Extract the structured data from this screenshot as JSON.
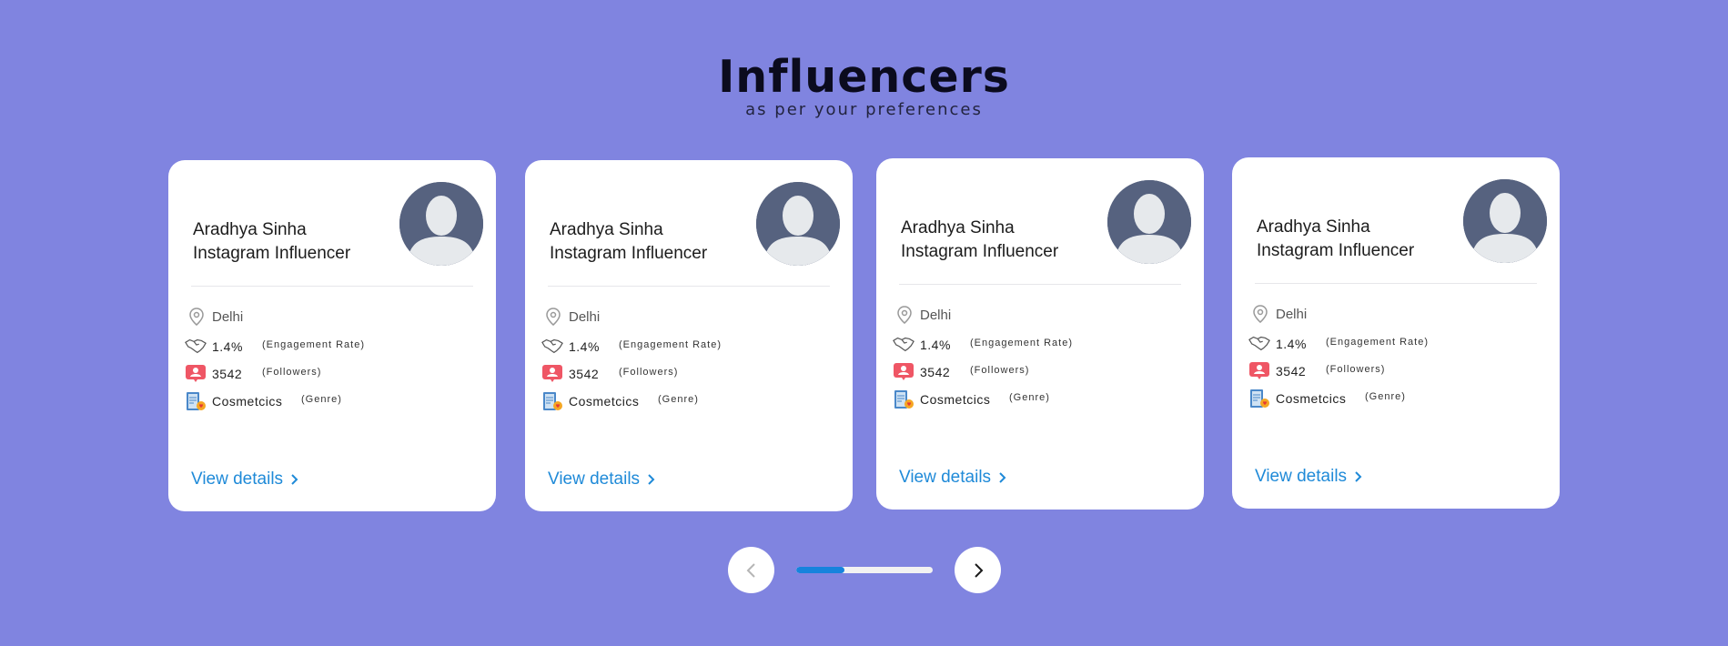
{
  "header": {
    "title": "Influencers",
    "subtitle": "as per your preferences"
  },
  "colors": {
    "background": "#8084e0",
    "link": "#1f8ad8",
    "progress": "#1683dd",
    "avatar": "#56627f"
  },
  "cards": [
    {
      "name": "Aradhya Sinha",
      "role": "Instagram Influencer",
      "location": "Delhi",
      "engagement_value": "1.4%",
      "engagement_label": "(Engagement Rate)",
      "followers_value": "3542",
      "followers_label": "(Followers)",
      "genre_value": "Cosmetcics",
      "genre_label": "(Genre)",
      "link_label": "View details"
    },
    {
      "name": "Aradhya Sinha",
      "role": "Instagram Influencer",
      "location": "Delhi",
      "engagement_value": "1.4%",
      "engagement_label": "(Engagement Rate)",
      "followers_value": "3542",
      "followers_label": "(Followers)",
      "genre_value": "Cosmetcics",
      "genre_label": "(Genre)",
      "link_label": "View details"
    },
    {
      "name": "Aradhya Sinha",
      "role": "Instagram Influencer",
      "location": "Delhi",
      "engagement_value": "1.4%",
      "engagement_label": "(Engagement Rate)",
      "followers_value": "3542",
      "followers_label": "(Followers)",
      "genre_value": "Cosmetcics",
      "genre_label": "(Genre)",
      "link_label": "View details"
    },
    {
      "name": "Aradhya Sinha",
      "role": "Instagram Influencer",
      "location": "Delhi",
      "engagement_value": "1.4%",
      "engagement_label": "(Engagement Rate)",
      "followers_value": "3542",
      "followers_label": "(Followers)",
      "genre_value": "Cosmetcics",
      "genre_label": "(Genre)",
      "link_label": "View details"
    }
  ],
  "carousel": {
    "progress_fraction": 0.35,
    "prev_icon": "chevron-left-icon",
    "next_icon": "chevron-right-icon"
  },
  "icons": {
    "location": "location-pin-icon",
    "engagement": "handshake-icon",
    "followers": "user-badge-icon",
    "genre": "cosmetics-book-icon"
  }
}
